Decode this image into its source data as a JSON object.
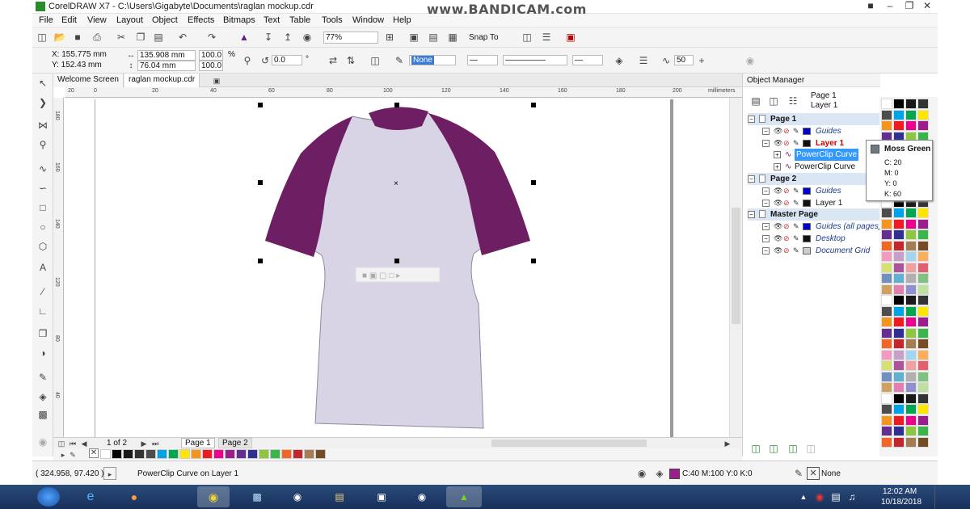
{
  "title_bar": {
    "title": "CorelDRAW X7 - C:\\Users\\Gigabyte\\Documents\\raglan mockup.cdr",
    "watermark": "www.BANDICAM.com"
  },
  "menu": [
    "File",
    "Edit",
    "View",
    "Layout",
    "Object",
    "Effects",
    "Bitmaps",
    "Text",
    "Table",
    "Tools",
    "Window",
    "Help"
  ],
  "standard_toolbar": {
    "zoom": "77%",
    "snap_to": "Snap To"
  },
  "property_bar": {
    "x": "X: 155.775 mm",
    "y": "Y: 152.43 mm",
    "width": "135.908 mm",
    "height": "76.04 mm",
    "scale_w": "100.0",
    "scale_h": "100.0",
    "percent": "%",
    "rotation": "0.0",
    "degree": "°",
    "fill_value": "None",
    "outline_value": "50"
  },
  "tabs": {
    "welcome": "Welcome Screen",
    "doc": "raglan mockup.cdr"
  },
  "ruler": {
    "units": "millimeters",
    "h_ticks": [
      "20",
      "0",
      "20",
      "40",
      "60",
      "80",
      "100",
      "120",
      "140",
      "160",
      "180",
      "200",
      "220",
      "240",
      "260",
      "280",
      "300"
    ],
    "v_ticks": [
      "40",
      "60",
      "80",
      "100",
      "120",
      "140",
      "160",
      "180",
      "200",
      "220"
    ]
  },
  "nav": {
    "page_count": "1 of 2",
    "pages": [
      "Page 1",
      "Page 2"
    ]
  },
  "object_manager": {
    "title": "Object Manager",
    "current_page": "Page 1",
    "current_layer": "Layer 1",
    "rows": [
      {
        "label": "Page 1",
        "kind": "page"
      },
      {
        "label": "Guides",
        "kind": "layer",
        "color": "#0000cc",
        "style": "italic"
      },
      {
        "label": "Layer 1",
        "kind": "layer",
        "color": "#111111",
        "style": "active"
      },
      {
        "label": "PowerClip Curve",
        "kind": "object",
        "style": "selected"
      },
      {
        "label": "PowerClip Curve",
        "kind": "object",
        "style": "normal"
      },
      {
        "label": "Page 2",
        "kind": "page"
      },
      {
        "label": "Guides",
        "kind": "layer",
        "color": "#0000cc",
        "style": "italic"
      },
      {
        "label": "Layer 1",
        "kind": "layer",
        "color": "#111111",
        "style": "normal"
      },
      {
        "label": "Master Page",
        "kind": "page"
      },
      {
        "label": "Guides (all pages)",
        "kind": "layer",
        "color": "#0000cc",
        "style": "italic"
      },
      {
        "label": "Desktop",
        "kind": "layer",
        "color": "#111111",
        "style": "italic"
      },
      {
        "label": "Document Grid",
        "kind": "layer",
        "color": "#cccccc",
        "style": "italic"
      }
    ]
  },
  "tooltip": {
    "name": "Moss Green",
    "c": "C: 20",
    "m": "M: 0",
    "y": "Y: 0",
    "k": "K: 60",
    "swatch": "#6f7a80"
  },
  "status_bar": {
    "coords": "( 324.958, 97.420 )",
    "object_info": "PowerClip Curve on Layer 1",
    "fill_info": "C:40 M:100 Y:0 K:0",
    "fill_color": "#9b1e8c",
    "outline_info": "None"
  },
  "taskbar": {
    "time": "12:02 AM",
    "date": "10/18/2018"
  },
  "garment": {
    "body_color": "#d8d4e6",
    "sleeve_color": "#6e1e62"
  },
  "palette_colors": [
    "#ffffff",
    "#000000",
    "#1a1a1a",
    "#333333",
    "#4d4d4d",
    "#00a2e8",
    "#00a650",
    "#ffe600",
    "#f7941d",
    "#ed1c24",
    "#ec008c",
    "#9b1e8c",
    "#662d91",
    "#2e3192",
    "#8dc63f",
    "#39b54a",
    "#f26522",
    "#c1272d",
    "#a67c52",
    "#754c24",
    "#f49ac1",
    "#c6a0c9",
    "#a3d5f0",
    "#fbaf5d",
    "#d5e26f",
    "#aa5599",
    "#f0a0a0",
    "#e06070",
    "#7090c0",
    "#60b0d0",
    "#b0b0b0",
    "#80c080",
    "#d0a060",
    "#e080b0",
    "#9090d0",
    "#c0e0a0"
  ]
}
